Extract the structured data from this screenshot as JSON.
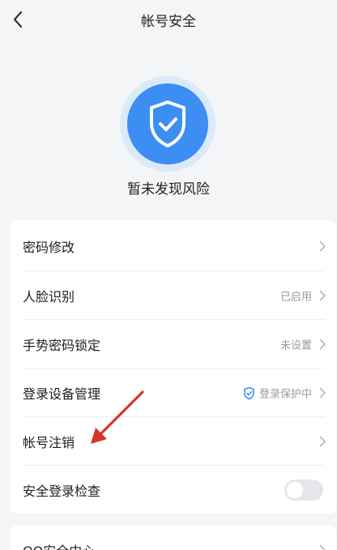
{
  "header": {
    "title": "帐号安全"
  },
  "status": {
    "text": "暂未发现风险"
  },
  "settings": [
    {
      "label": "密码修改",
      "value": ""
    },
    {
      "label": "人脸识别",
      "value": "已启用"
    },
    {
      "label": "手势密码锁定",
      "value": "未设置"
    },
    {
      "label": "登录设备管理",
      "value": "登录保护中"
    },
    {
      "label": "帐号注销",
      "value": ""
    },
    {
      "label": "安全登录检查",
      "toggle_on": false
    }
  ],
  "more": {
    "label": "QQ安全中心"
  },
  "colors": {
    "accent": "#3c8ef2",
    "arrow": "#d9342b"
  }
}
